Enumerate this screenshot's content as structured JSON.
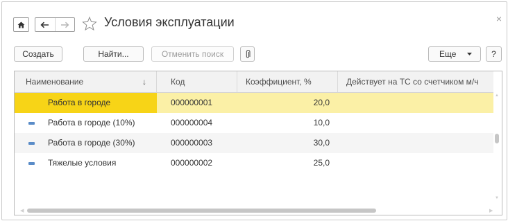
{
  "window": {
    "title": "Условия эксплуатации",
    "close_label": "×"
  },
  "toolbar": {
    "create_label": "Создать",
    "find_label": "Найти...",
    "cancel_search_label": "Отменить поиск",
    "more_label": "Еще",
    "help_label": "?"
  },
  "table": {
    "columns": [
      "Наименование",
      "Код",
      "Коэффициент, %",
      "Действует на ТС со счетчиком м/ч"
    ],
    "sort_indicator": "↓",
    "rows": [
      {
        "name": "Работа в городе",
        "code": "000000001",
        "coef": "20,0",
        "meter": "",
        "selected": true
      },
      {
        "name": "Работа в городе (10%)",
        "code": "000000004",
        "coef": "10,0",
        "meter": "",
        "selected": false
      },
      {
        "name": "Работа в городе (30%)",
        "code": "000000003",
        "coef": "30,0",
        "meter": "",
        "selected": false
      },
      {
        "name": "Тяжелые условия",
        "code": "000000002",
        "coef": "25,0",
        "meter": "",
        "selected": false
      }
    ]
  },
  "colors": {
    "selected_row": "#fbf0a6",
    "selected_cell": "#f7d417",
    "row_icon": "#5a8cc8"
  },
  "icons": [
    "home-icon",
    "back-arrow-icon",
    "forward-arrow-icon",
    "favorite-star-icon",
    "paperclip-icon",
    "dropdown-caret-icon",
    "close-icon",
    "row-item-icon"
  ]
}
